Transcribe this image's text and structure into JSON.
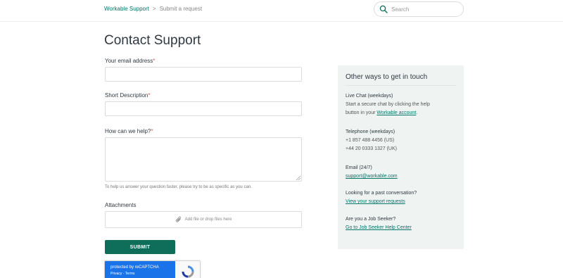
{
  "breadcrumb": {
    "home": "Workable Support",
    "separator": ">",
    "current": "Submit a request"
  },
  "search": {
    "placeholder": "Search"
  },
  "page": {
    "title": "Contact Support"
  },
  "form": {
    "email_label": "Your email address",
    "short_desc_label": "Short Description",
    "help_label": "How can we help?",
    "required_marker": "*",
    "hint": "To help us answer your question faster, please try to be as specific as you can.",
    "attachments_label": "Attachments",
    "attach_prompt": "Add file or drop files here",
    "submit_label": "SUBMIT"
  },
  "recaptcha": {
    "text": "protected by reCAPTCHA",
    "links": "Privacy - Terms"
  },
  "sidebar": {
    "title": "Other ways to get in touch",
    "live_chat": {
      "heading": "Live Chat (weekdays)",
      "text": "Start a secure chat by clicking the help button in your",
      "link": "Workable account",
      "suffix": "."
    },
    "telephone": {
      "heading": "Telephone (weekdays)",
      "us": "+1 857 488 4456 (US)",
      "uk": "+44 20 0333 1327 (UK)"
    },
    "email": {
      "heading": "Email (24/7)",
      "address": "support@workable.com"
    },
    "past": {
      "heading": "Looking for a past conversation?",
      "link": "View your support requests"
    },
    "seeker": {
      "heading": "Are you a Job Seeker?",
      "link": "Go to Job Seeker Help Center"
    }
  },
  "colors": {
    "accent": "#00756a",
    "button": "#0f6e5a",
    "required": "#d9534f",
    "sidebar_bg": "#eff4f3"
  },
  "icons": {
    "search": "search-icon",
    "attach": "paperclip-icon",
    "recaptcha": "recaptcha-logo-icon"
  }
}
